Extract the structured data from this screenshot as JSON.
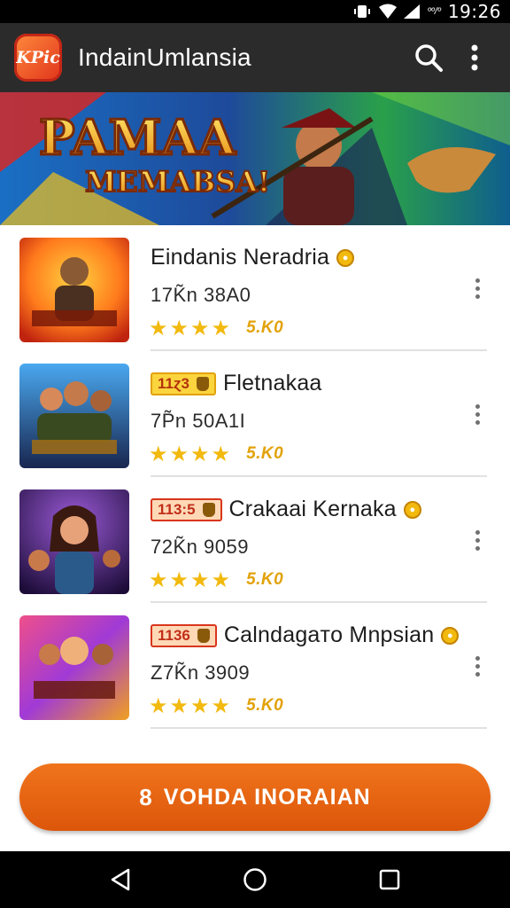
{
  "status_bar": {
    "time": "19:26",
    "network_label": "ºº/º"
  },
  "app_bar": {
    "logo_text": "KPic",
    "title": "IndainUmlansia"
  },
  "banner": {
    "title_line1": "PAMAA",
    "title_line2": "MEMABSA!"
  },
  "items": [
    {
      "title": "Eindanis Neradria",
      "tag": null,
      "stats": "17K̃n 38A0",
      "rating_text": "5.K0",
      "stars": 4,
      "thumb_palette": [
        "#ff9a1c",
        "#e2301a"
      ]
    },
    {
      "title": "Fletnakaa",
      "tag": "11ɀ3",
      "stats": "7P̃n 50A1I",
      "rating_text": "5.K0",
      "stars": 4,
      "thumb_palette": [
        "#3b8fd6",
        "#17245a"
      ]
    },
    {
      "title": "Crakaai Kernaka",
      "tag": "113:5",
      "stats": "72K̃n 9059",
      "rating_text": "5.K0",
      "stars": 4,
      "thumb_palette": [
        "#7d3fc2",
        "#221040"
      ]
    },
    {
      "title": "Calndagaᴛo Mnpsian",
      "tag": "1136",
      "stats": "Z7K̃n 3909",
      "rating_text": "5.K0",
      "stars": 4,
      "thumb_palette": [
        "#e0407a",
        "#7a2bd0"
      ]
    }
  ],
  "cta": {
    "label": "VOHDA INORAIAN",
    "icon": "8"
  },
  "colors": {
    "accent": "#e8661a",
    "star": "#f2b90e",
    "appbar": "#2b2b2b"
  }
}
